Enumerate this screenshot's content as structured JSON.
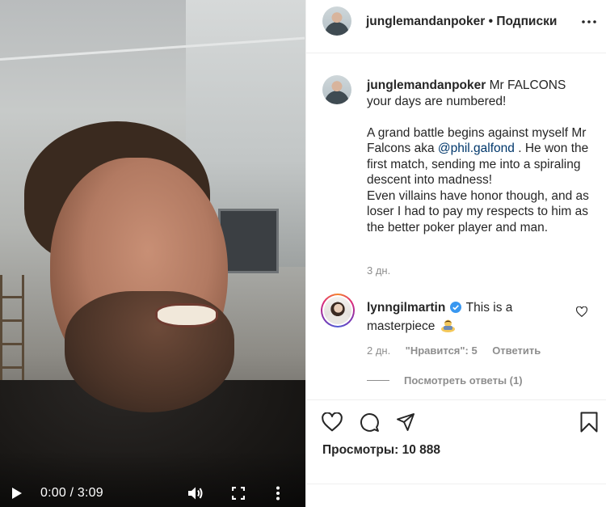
{
  "video": {
    "time": "0:00 / 3:09",
    "play_icon": "play-icon",
    "volume_icon": "volume-icon",
    "fullscreen_icon": "fullscreen-icon",
    "more_icon": "more-vertical-icon"
  },
  "header": {
    "username": "junglemandanpoker",
    "separator": " • ",
    "follow_state": "Подписки",
    "more_icon": "more-horizontal-icon"
  },
  "caption": {
    "username": "junglemandanpoker",
    "line1": " Mr FALCONS your days are numbered!",
    "para2_before": "A grand battle begins against myself Mr Falcons aka ",
    "mention": "@phil.galfond",
    "para2_after": " . He won the first match, sending me into a spiraling descent into madness!",
    "para3": "Even villains have honor though, and as loser I had to pay my respects to him as the better poker player and man.",
    "time": "3 дн."
  },
  "comment": {
    "username": "lynngilmartin",
    "verified_icon": "verified-badge-icon",
    "text": "This is a masterpiece",
    "emoji_icon": "bowing-person-emoji-icon",
    "time": "2 дн.",
    "likes": "\"Нравится\": 5",
    "reply": "Ответить",
    "heart_icon": "heart-outline-icon",
    "view_replies": "Посмотреть ответы (1)"
  },
  "actions": {
    "like_icon": "heart-icon",
    "comment_icon": "comment-icon",
    "share_icon": "share-icon",
    "save_icon": "bookmark-icon"
  },
  "stats": {
    "views": "Просмотры: 10 888"
  }
}
